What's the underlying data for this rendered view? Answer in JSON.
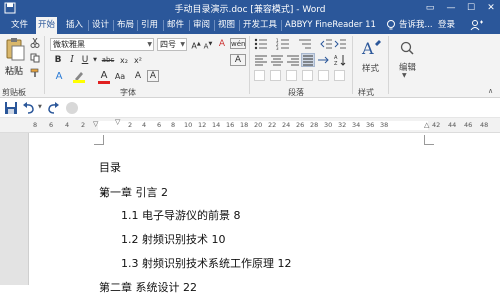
{
  "window": {
    "title": "手动目录演示.doc [兼容模式] - Word"
  },
  "tabs": [
    "文件",
    "开始",
    "插入",
    "设计",
    "布局",
    "引用",
    "邮件",
    "审阅",
    "视图",
    "开发工具",
    "ABBYY FineReader 11"
  ],
  "active_tab": "开始",
  "tell_me": "告诉我...",
  "login": "登录",
  "clipboard": {
    "paste_label": "粘贴",
    "group_label": "剪贴板"
  },
  "font": {
    "name": "微软雅黑",
    "size": "四号",
    "wen": "wén",
    "aa": "Aa",
    "bold": "B",
    "italic": "I",
    "underline": "U",
    "strike": "abc",
    "sub": "x₂",
    "sup": "x²",
    "font_color_a": "A",
    "group_label": "字体"
  },
  "paragraph": {
    "group_label": "段落"
  },
  "styles": {
    "label": "样式",
    "group_label": "样式"
  },
  "editing": {
    "label": "编辑"
  },
  "ruler": {
    "left_numbers": [
      "8",
      "6",
      "4",
      "2"
    ],
    "right_numbers": [
      "2",
      "4",
      "6",
      "8",
      "10",
      "12",
      "14",
      "16",
      "18",
      "20",
      "22",
      "24",
      "26",
      "28",
      "30",
      "32",
      "34",
      "36",
      "38"
    ],
    "far_numbers": [
      "42",
      "44",
      "46",
      "48"
    ]
  },
  "document": {
    "lines": [
      "目录",
      "第一章  引言  2",
      "1.1  电子导游仪的前景  8",
      "1.2  射频识别技术  10",
      "1.3  射频识别技术系统工作原理  12",
      "第二章  系统设计  22"
    ]
  },
  "colors": {
    "accent": "#2b579a",
    "ribbon": "#f3f3f3",
    "font_color_red": "#e02020",
    "highlight_yellow": "#ffff00"
  }
}
